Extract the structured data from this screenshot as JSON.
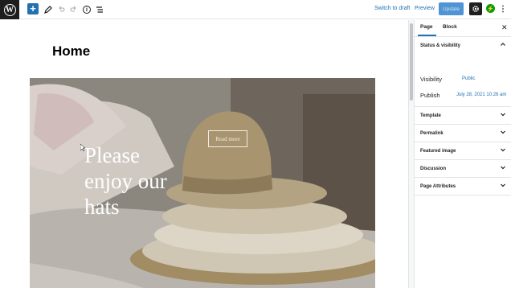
{
  "toolbar": {
    "switch_to_draft": "Switch to draft",
    "preview": "Preview",
    "update": "Update"
  },
  "editor": {
    "page_title": "Home",
    "cover": {
      "heading_lines": [
        "Please",
        "enjoy our",
        "hats"
      ],
      "button_label": "Read more"
    }
  },
  "sidebar": {
    "tabs": [
      "Page",
      "Block"
    ],
    "active_tab": "Page",
    "status_panel": {
      "title": "Status & visibility",
      "visibility_label": "Visibility",
      "visibility_value": "Public",
      "publish_label": "Publish",
      "publish_value": "July 28, 2021 10:26 am"
    },
    "panels": [
      "Template",
      "Permalink",
      "Featured image",
      "Discussion",
      "Page Attributes"
    ]
  },
  "colors": {
    "accent": "#2271b1",
    "update_button": "#4f94d4",
    "topbar_dark": "#1e1e1e",
    "jetpack": "#069e08"
  },
  "icons": [
    "wordpress-logo-icon",
    "plus-icon",
    "pencil-icon",
    "undo-icon",
    "redo-icon",
    "info-icon",
    "list-view-icon",
    "gear-icon",
    "jetpack-icon",
    "more-options-icon",
    "close-icon",
    "chevron-up-icon",
    "chevron-down-icon"
  ]
}
